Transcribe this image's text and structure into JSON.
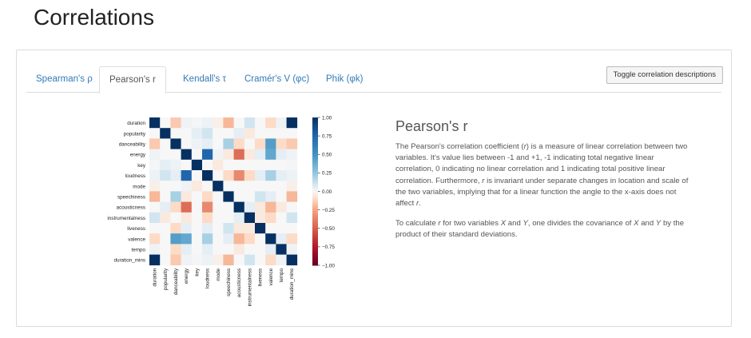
{
  "page": {
    "title": "Correlations"
  },
  "tabs": [
    {
      "label": "Spearman's ρ",
      "active": false
    },
    {
      "label": "Pearson's r",
      "active": true
    },
    {
      "label": "Kendall's τ",
      "active": false
    },
    {
      "label": "Cramér's V (φc)",
      "active": false
    },
    {
      "label": "Phik (φk)",
      "active": false
    }
  ],
  "toggle_button": {
    "label": "Toggle correlation descriptions"
  },
  "description": {
    "heading": "Pearson's r",
    "p1": [
      {
        "t": "The Pearson's correlation coefficient ("
      },
      {
        "i": "r"
      },
      {
        "t": ") is a measure of linear correlation between two variables. It's value lies between -1 and +1, -1 indicating total negative linear correlation, 0 indicating no linear correlation and 1 indicating total positive linear correlation. Furthermore, "
      },
      {
        "i": "r"
      },
      {
        "t": " is invariant under separate changes in location and scale of the two variables, implying that for a linear function the angle to the x-axis does not affect "
      },
      {
        "i": "r"
      },
      {
        "t": "."
      }
    ],
    "p2": [
      {
        "t": "To calculate "
      },
      {
        "i": "r"
      },
      {
        "t": " for two variables "
      },
      {
        "i": "X"
      },
      {
        "t": " and "
      },
      {
        "i": "Y"
      },
      {
        "t": ", one divides the covariance of "
      },
      {
        "i": "X"
      },
      {
        "t": " and "
      },
      {
        "i": "Y"
      },
      {
        "t": " by the product of their standard deviations."
      }
    ]
  },
  "chart_data": {
    "type": "heatmap",
    "labels": [
      "duration",
      "popularity",
      "danceability",
      "energy",
      "key",
      "loudness",
      "mode",
      "speechiness",
      "acousticness",
      "instrumentalness",
      "liveness",
      "valence",
      "tempo",
      "duration_mins"
    ],
    "matrix": [
      [
        1.0,
        0.0,
        -0.15,
        0.02,
        0.01,
        0.03,
        -0.03,
        -0.2,
        0.0,
        0.1,
        0.0,
        -0.1,
        0.02,
        1.0
      ],
      [
        0.0,
        1.0,
        0.0,
        0.0,
        0.05,
        0.1,
        0.0,
        0.0,
        0.05,
        -0.05,
        0.0,
        0.0,
        0.0,
        0.0
      ],
      [
        -0.15,
        0.0,
        1.0,
        0.0,
        0.03,
        0.05,
        0.0,
        0.2,
        -0.1,
        0.0,
        -0.1,
        0.45,
        -0.1,
        -0.15
      ],
      [
        0.02,
        0.0,
        0.0,
        1.0,
        0.0,
        0.75,
        0.02,
        -0.05,
        -0.45,
        -0.05,
        0.05,
        0.4,
        0.05,
        0.02
      ],
      [
        0.01,
        0.05,
        0.03,
        0.0,
        1.0,
        0.0,
        -0.05,
        0.0,
        0.0,
        0.0,
        0.0,
        0.0,
        0.0,
        0.01
      ],
      [
        0.03,
        0.1,
        0.05,
        0.75,
        0.0,
        1.0,
        0.0,
        -0.1,
        -0.35,
        -0.1,
        0.05,
        0.2,
        0.05,
        0.03
      ],
      [
        -0.03,
        0.0,
        0.0,
        0.02,
        -0.05,
        0.0,
        1.0,
        0.0,
        0.0,
        0.0,
        0.0,
        0.0,
        0.0,
        -0.03
      ],
      [
        -0.2,
        0.0,
        0.2,
        -0.05,
        0.0,
        -0.1,
        0.0,
        1.0,
        0.0,
        0.0,
        0.1,
        0.05,
        0.0,
        -0.2
      ],
      [
        0.0,
        0.05,
        -0.1,
        -0.45,
        0.0,
        -0.35,
        0.0,
        0.0,
        1.0,
        0.05,
        -0.05,
        -0.2,
        -0.05,
        0.0
      ],
      [
        0.1,
        -0.05,
        0.0,
        -0.05,
        0.0,
        -0.1,
        0.0,
        0.0,
        0.05,
        1.0,
        -0.05,
        -0.1,
        0.0,
        0.1
      ],
      [
        0.0,
        0.0,
        -0.1,
        0.05,
        0.0,
        0.05,
        0.0,
        0.1,
        -0.05,
        -0.05,
        1.0,
        0.0,
        0.0,
        0.0
      ],
      [
        -0.1,
        0.0,
        0.45,
        0.4,
        0.0,
        0.2,
        0.0,
        0.05,
        -0.2,
        -0.1,
        0.0,
        1.0,
        0.05,
        -0.1
      ],
      [
        0.02,
        0.0,
        -0.1,
        0.05,
        0.0,
        0.05,
        0.0,
        0.0,
        -0.05,
        0.0,
        0.0,
        0.05,
        1.0,
        0.02
      ],
      [
        1.0,
        0.0,
        -0.15,
        0.02,
        0.01,
        0.03,
        -0.03,
        -0.2,
        0.0,
        0.1,
        0.0,
        -0.1,
        0.02,
        1.0
      ]
    ],
    "colorbar_ticks": [
      "1.00",
      "0.75",
      "0.50",
      "0.25",
      "0.00",
      "−0.25",
      "−0.50",
      "−0.75",
      "−1.00"
    ],
    "range": [
      -1,
      1
    ],
    "colors": {
      "positive": "#053061",
      "zero": "#f7f7f7",
      "negative": "#67001f"
    }
  }
}
